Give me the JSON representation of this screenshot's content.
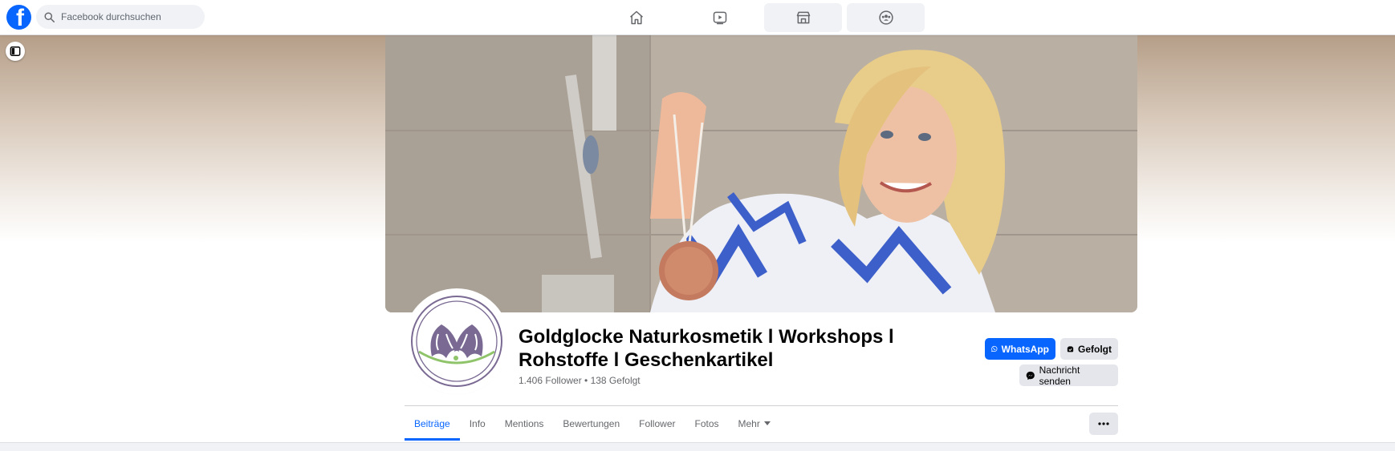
{
  "topbar": {
    "logo_letter": "f",
    "search_placeholder": "Facebook durchsuchen",
    "nav_icons": [
      "home-icon",
      "video-icon",
      "marketplace-icon",
      "groups-icon"
    ]
  },
  "page": {
    "title": "Goldglocke Naturkosmetik l Workshops l Rohstoffe l Geschenkartikel",
    "stats": "1.406 Follower • 138 Gefolgt"
  },
  "actions": {
    "whatsapp": "WhatsApp",
    "following": "Gefolgt",
    "message": "Nachricht senden"
  },
  "tabs": [
    {
      "label": "Beiträge"
    },
    {
      "label": "Info"
    },
    {
      "label": "Mentions"
    },
    {
      "label": "Bewertungen"
    },
    {
      "label": "Follower"
    },
    {
      "label": "Fotos"
    },
    {
      "label": "Mehr"
    }
  ],
  "colors": {
    "accent": "#0866ff",
    "button_gray": "#e4e6eb",
    "logo_purple": "#7a6a93",
    "logo_green": "#8fc46a"
  }
}
